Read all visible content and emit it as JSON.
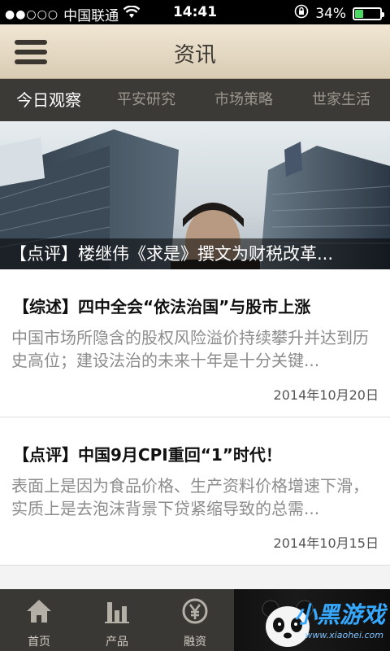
{
  "status_bar": {
    "signal_dots": "●●○○○",
    "carrier": "中国联通",
    "time": "14:41",
    "battery_percent": "34%",
    "battery_level": 0.34,
    "battery_color": "#4cd964"
  },
  "header": {
    "title": "资讯",
    "menu_icon": "hamburger-menu-icon"
  },
  "tabs": [
    {
      "label": "今日观察",
      "active": true
    },
    {
      "label": "平安研究",
      "active": false
    },
    {
      "label": "市场策略",
      "active": false
    },
    {
      "label": "世家生活",
      "active": false
    }
  ],
  "banner": {
    "caption": "【点评】楼继伟《求是》撰文为财税改革..."
  },
  "articles": [
    {
      "title": "【综述】四中全会“依法治国”与股市上涨",
      "summary": "中国市场所隐含的股权风险溢价持续攀升并达到历史高位；建设法治的未来十年是十分关键...",
      "date": "2014年10月20日"
    },
    {
      "title": "【点评】中国9月CPI重回“1”时代！",
      "summary": "表面上是因为食品价格、生产资料价格增速下滑，实质上是去泡沫背景下贷紧缩导致的总需...",
      "date": "2014年10月15日"
    }
  ],
  "bottom_nav": [
    {
      "label": "首页",
      "icon": "home-icon"
    },
    {
      "label": "产品",
      "icon": "chart-bars-icon"
    },
    {
      "label": "融资",
      "icon": "yen-coin-icon"
    }
  ],
  "watermark": {
    "text": "小黑游戏",
    "url_text": "www.xiaohei.com"
  },
  "colors": {
    "header_bg": "#e8dcc6",
    "tab_bar_bg": "#3c3a37",
    "bottom_nav_bg": "#3a3835",
    "watermark_blue": "#36a9ff"
  }
}
